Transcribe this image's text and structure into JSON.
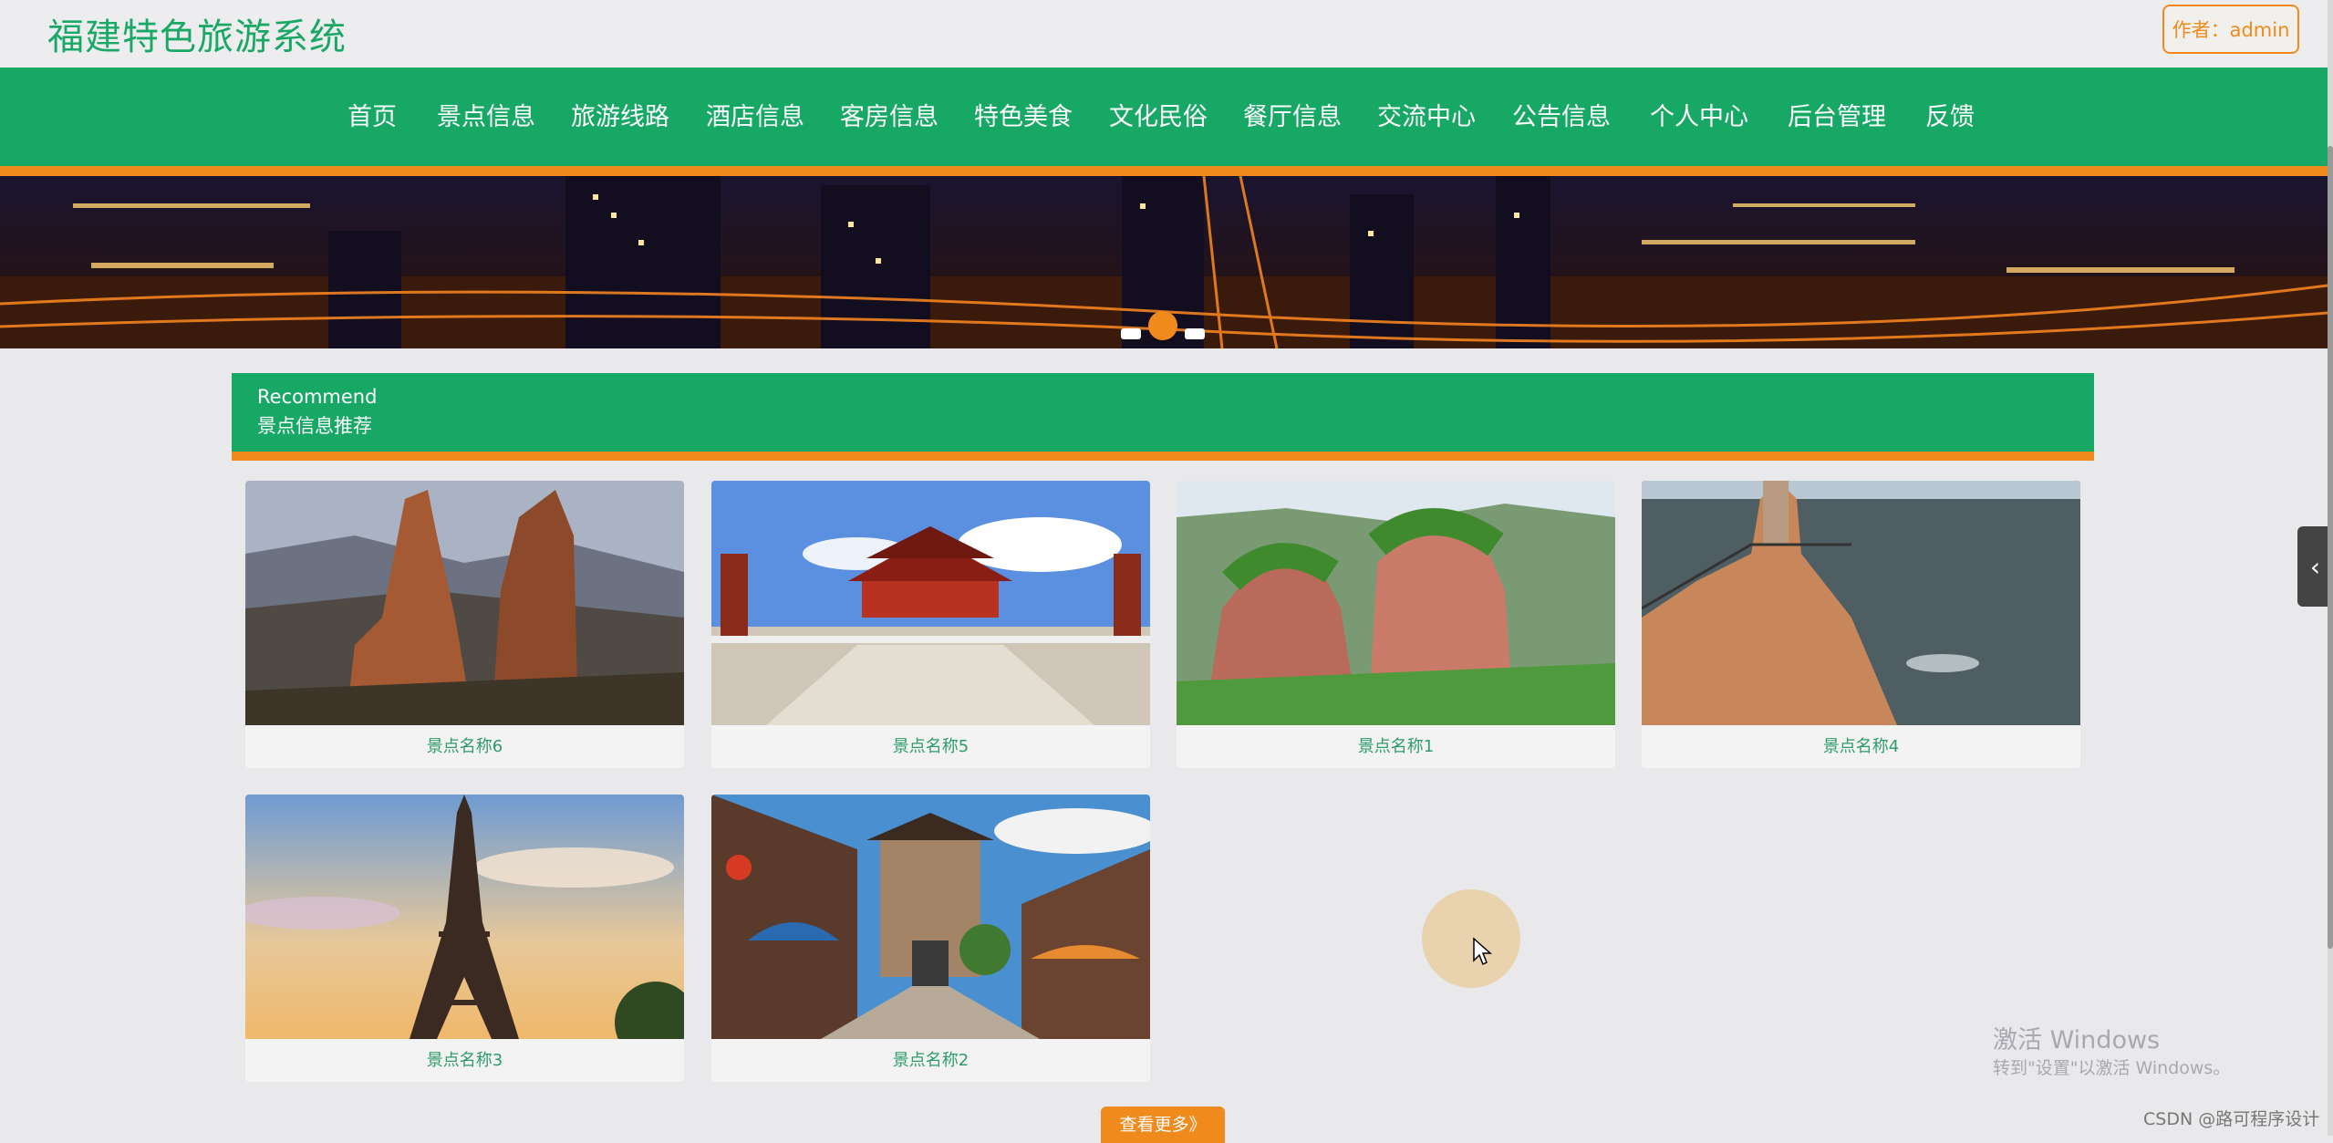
{
  "site": {
    "title": "福建特色旅游系统",
    "author_label": "作者：admin"
  },
  "nav": {
    "items": [
      "首页",
      "景点信息",
      "旅游线路",
      "酒店信息",
      "客房信息",
      "特色美食",
      "文化民俗",
      "餐厅信息",
      "交流中心",
      "公告信息",
      "个人中心",
      "后台管理",
      "反馈"
    ]
  },
  "banner": {
    "slide_count": 3,
    "active_slide": 2
  },
  "section": {
    "title_en": "Recommend",
    "title_cn": "景点信息推荐"
  },
  "cards": [
    {
      "name": "景点名称6",
      "image": "rock-pillars-mountain"
    },
    {
      "name": "景点名称5",
      "image": "red-temple-plaza"
    },
    {
      "name": "景点名称1",
      "image": "green-cliffs"
    },
    {
      "name": "景点名称4",
      "image": "sea-cliff-tower"
    },
    {
      "name": "景点名称3",
      "image": "eiffel-tower"
    },
    {
      "name": "景点名称2",
      "image": "ancient-town-street"
    }
  ],
  "more_button": "查看更多》",
  "windows_watermark": {
    "line1": "激活 Windows",
    "line2": "转到\"设置\"以激活 Windows。"
  },
  "credit": "CSDN @路可程序设计",
  "colors": {
    "primary_green": "#17a865",
    "accent_orange": "#f08a1c",
    "title_green": "#1aa866"
  }
}
